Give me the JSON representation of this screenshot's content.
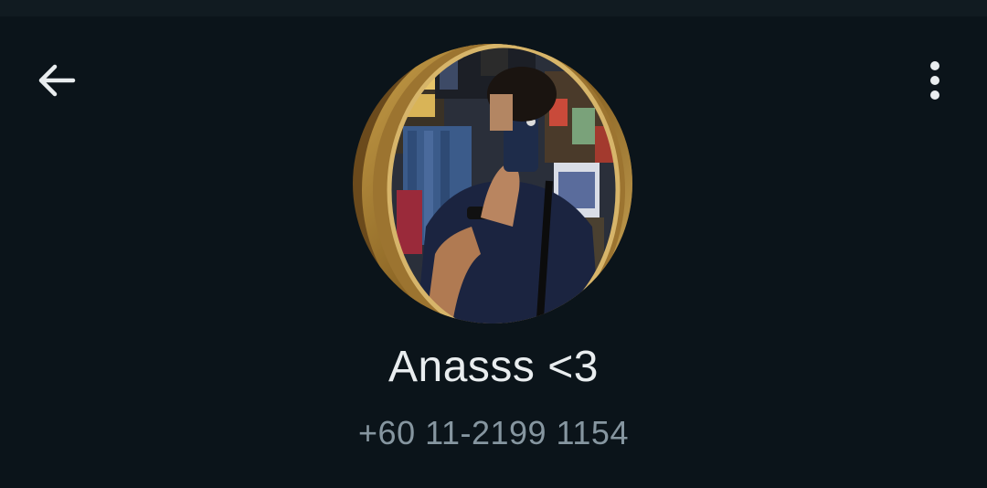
{
  "contact": {
    "name": "Anasss <3",
    "phone": "+60 11-2199 1154"
  },
  "toolbar": {
    "back_icon": "arrow-left-icon",
    "menu_icon": "more-vertical-icon"
  },
  "colors": {
    "background": "#0b141a",
    "name_text": "#e9edef",
    "phone_text": "#8696a0",
    "icon": "#e9edef"
  }
}
